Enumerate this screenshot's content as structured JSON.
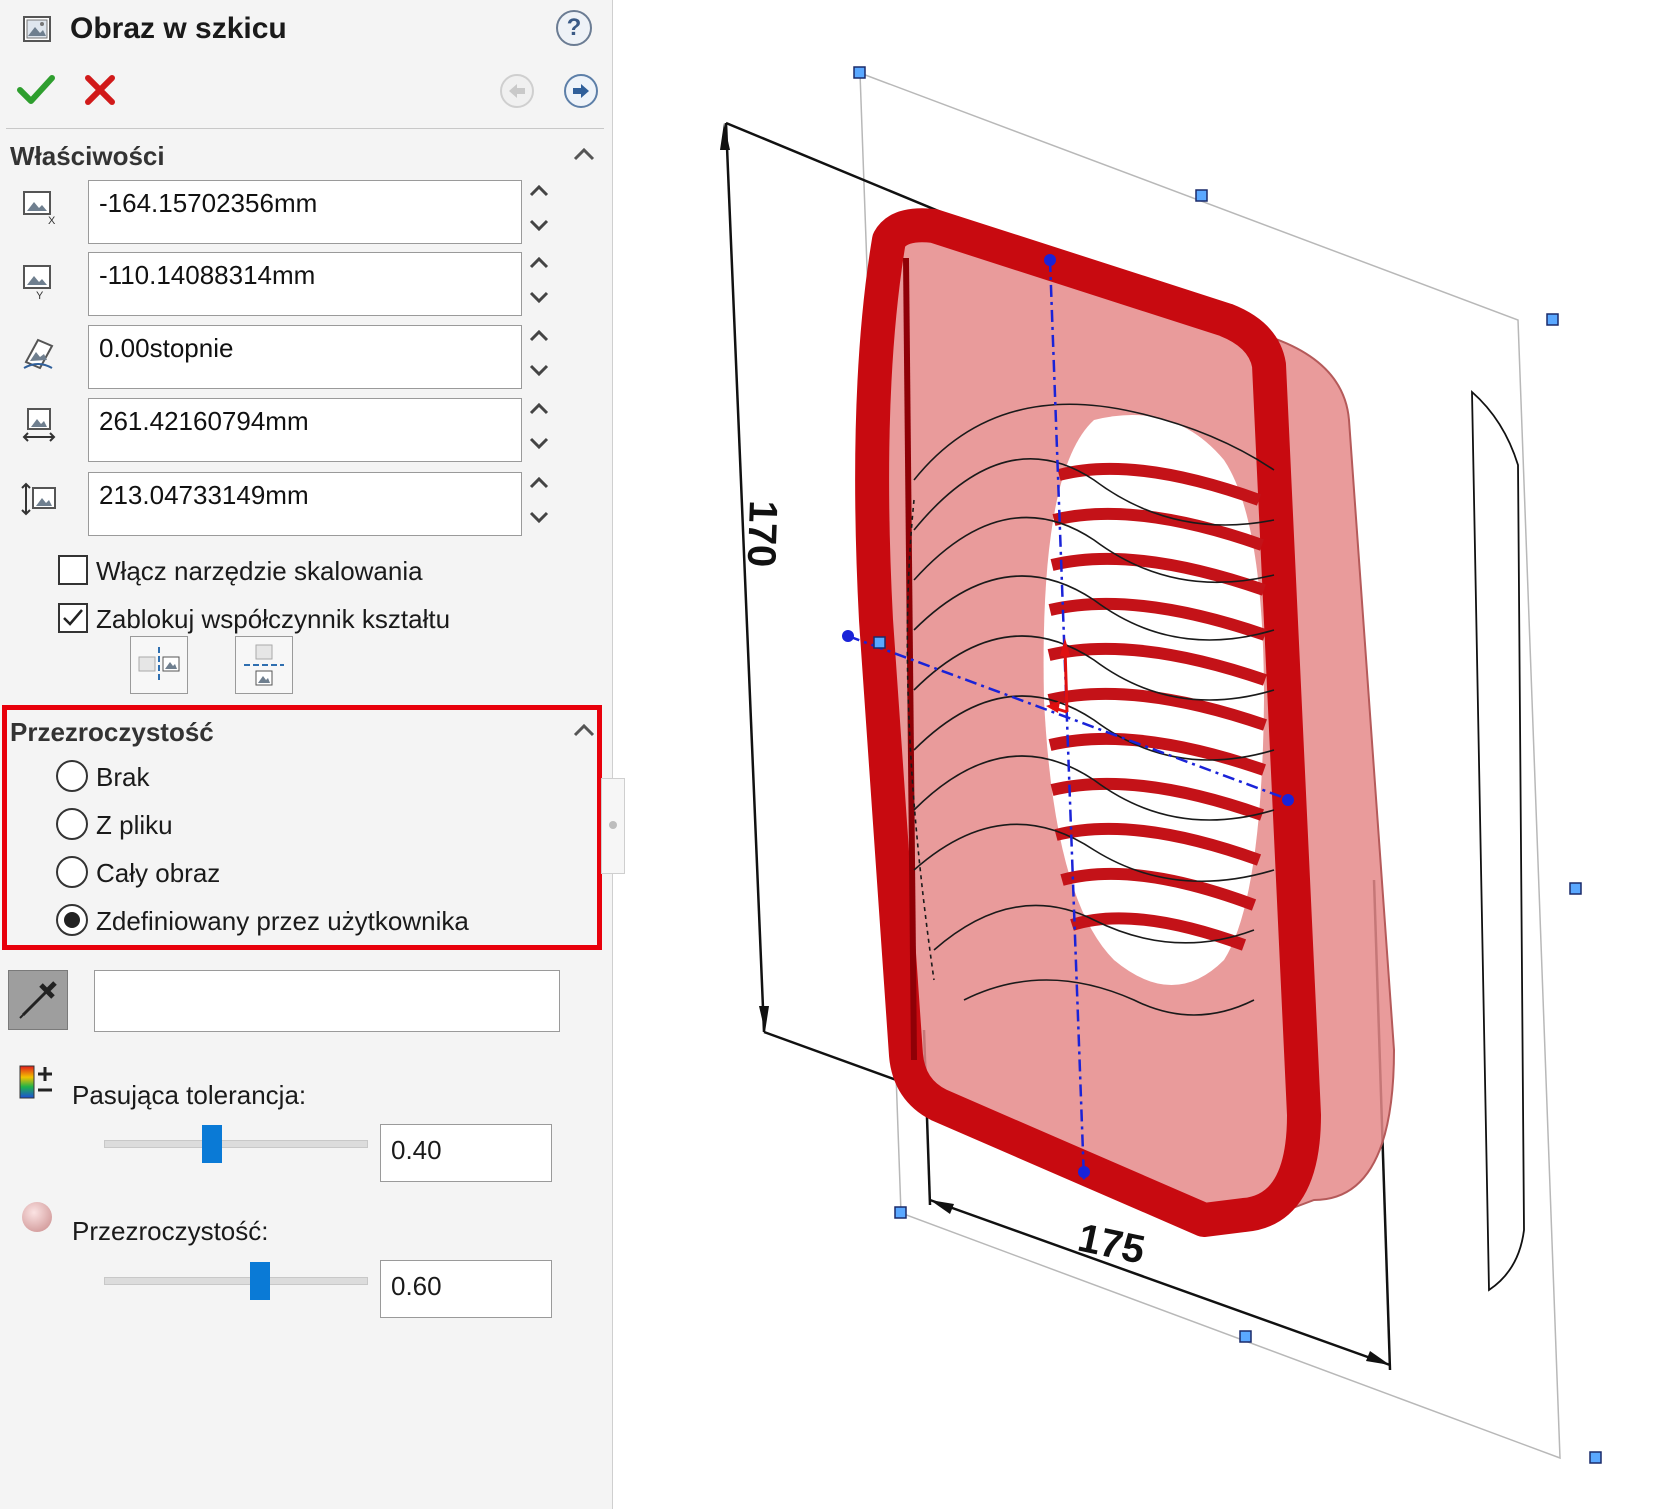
{
  "panel": {
    "title": "Obraz w szkicu",
    "help": "?",
    "properties": {
      "title": "Właściwości",
      "fields": [
        {
          "icon": "position-x-icon",
          "value": "-164.15702356mm"
        },
        {
          "icon": "position-y-icon",
          "value": "-110.14088314mm"
        },
        {
          "icon": "angle-icon",
          "value": "0.00stopnie"
        },
        {
          "icon": "width-icon",
          "value": "261.42160794mm"
        },
        {
          "icon": "height-icon",
          "value": "213.04733149mm"
        }
      ],
      "enable_scaling": {
        "label": "Włącz narzędzie skalowania",
        "checked": false
      },
      "lock_aspect": {
        "label": "Zablokuj współczynnik kształtu",
        "checked": true
      }
    },
    "transparency": {
      "title": "Przezroczystość",
      "options": [
        "Brak",
        "Z pliku",
        "Cały obraz",
        "Zdefiniowany przez użytkownika"
      ],
      "selected": "Zdefiniowany przez użytkownika",
      "tolerance_label": "Pasująca tolerancja:",
      "tolerance_value": "0.40",
      "tolerance_level": 0.4,
      "transparency_label": "Przezroczystość:",
      "transparency_value": "0.60",
      "transparency_level": 0.6
    }
  },
  "viewport": {
    "dim_height": "170",
    "dim_width": "175"
  },
  "colors": {
    "highlight": "#e8000b",
    "accent": "#0a7ad6",
    "ok": "#2e9e2e",
    "cancel": "#d11a1a",
    "part_red": "#d40d12"
  }
}
